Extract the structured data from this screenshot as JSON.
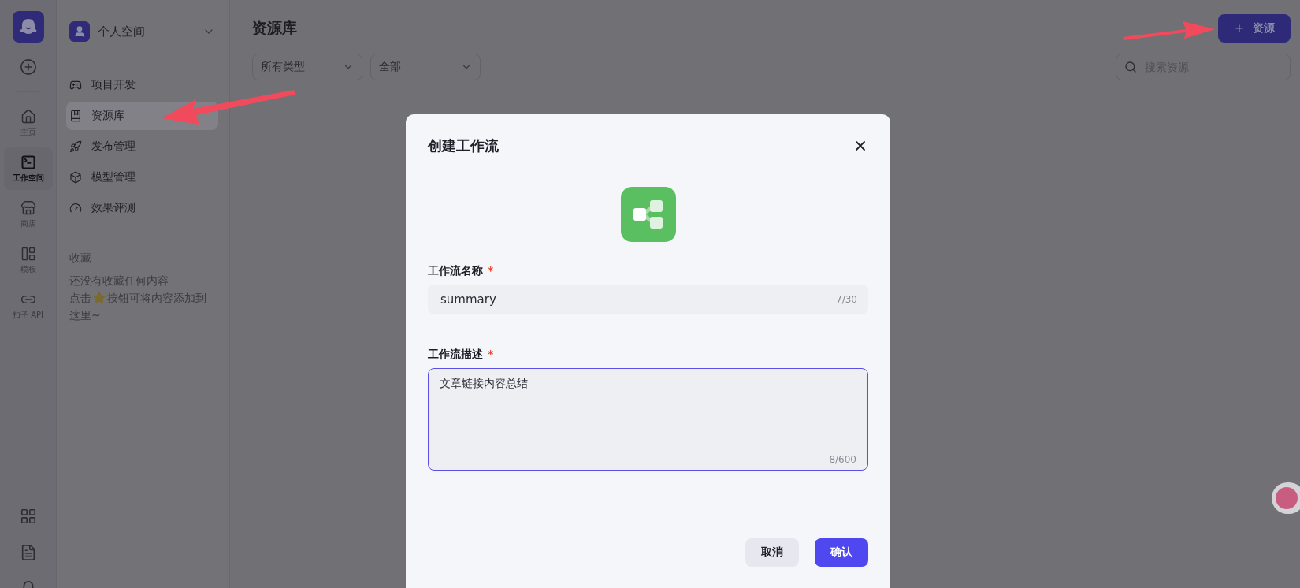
{
  "rail": {
    "items": [
      {
        "label": "主页",
        "selected": false
      },
      {
        "label": "工作空间",
        "selected": true
      },
      {
        "label": "商店",
        "selected": false
      },
      {
        "label": "模板",
        "selected": false
      },
      {
        "label": "扣子 API",
        "selected": false
      }
    ]
  },
  "sidebar": {
    "workspace": "个人空间",
    "nav": [
      {
        "label": "项目开发",
        "selected": false
      },
      {
        "label": "资源库",
        "selected": true
      },
      {
        "label": "发布管理",
        "selected": false
      },
      {
        "label": "模型管理",
        "selected": false
      },
      {
        "label": "效果评测",
        "selected": false
      }
    ],
    "favorites": {
      "title": "收藏",
      "empty_line_1": "还没有收藏任何内容",
      "empty_line_2_before": "点击",
      "empty_line_2_after": "按钮可将内容添加到",
      "empty_line_3": "这里~"
    }
  },
  "main": {
    "title": "资源库",
    "filters": [
      "所有类型",
      "全部"
    ],
    "search": {
      "placeholder": "搜索资源"
    },
    "add_button": "资源"
  },
  "modal": {
    "title": "创建工作流",
    "name_field": {
      "label": "工作流名称",
      "required_mark": "*",
      "value": "summary",
      "count": "7/30"
    },
    "description_field": {
      "label": "工作流描述",
      "required_mark": "*",
      "value": "文章链接内容总结",
      "count": "8/600",
      "focused": true
    },
    "buttons": {
      "cancel": "取消",
      "confirm": "确认"
    }
  }
}
